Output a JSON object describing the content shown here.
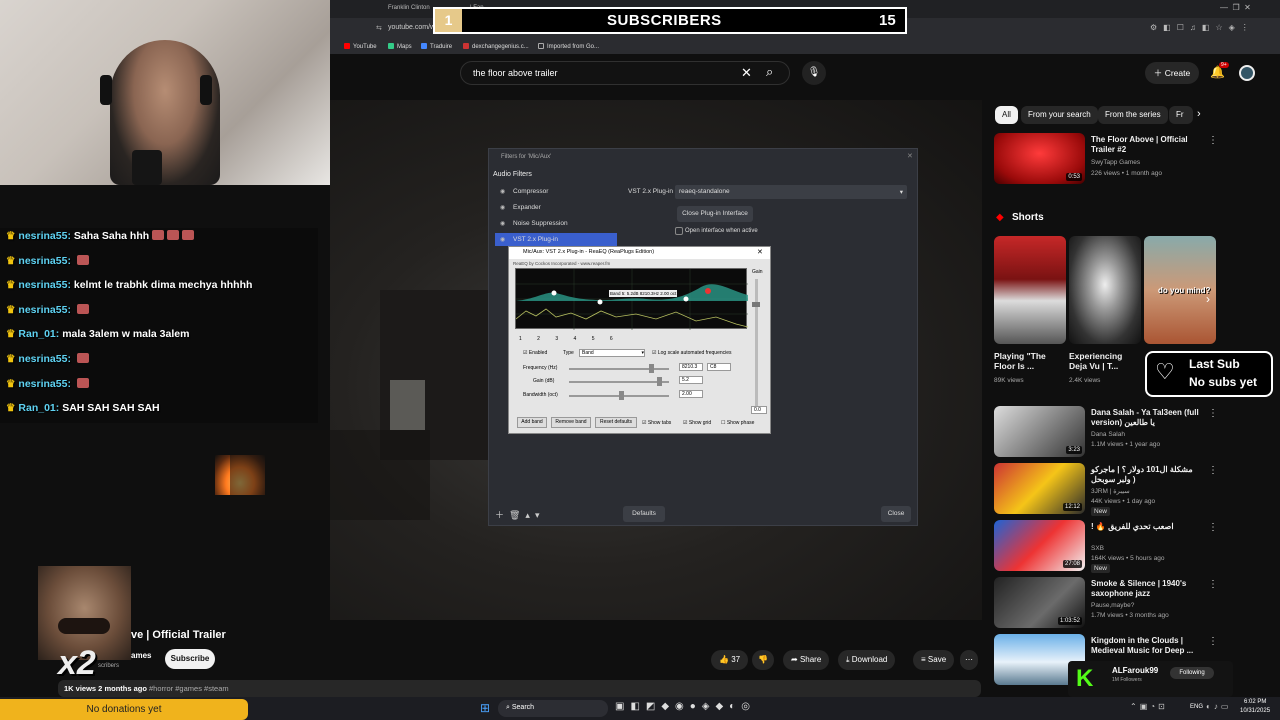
{
  "browser": {
    "tabs": [
      "Franklin Clinton",
      "| Fan"
    ],
    "url": "youtube.com/watch?v=AVNJbbKOydc",
    "bookmarks": [
      "YouTube",
      "Maps",
      "Traduire",
      "dexchangegenius.c...",
      "Imported from Go..."
    ]
  },
  "overlay": {
    "subscribers_label": "SUBSCRIBERS",
    "subscribers_count": "15",
    "subscribers_left": "1",
    "last_sub_title": "Last Sub",
    "last_sub_value": "No subs yet",
    "donations": "No donations yet",
    "multiplier": "x2"
  },
  "chat": [
    {
      "user": "nesrina55:",
      "msg": "Saha Saha hhh"
    },
    {
      "user": "nesrina55:",
      "msg": ""
    },
    {
      "user": "nesrina55:",
      "msg": "kelmt le trabhk dima mechya hhhhh"
    },
    {
      "user": "nesrina55:",
      "msg": ""
    },
    {
      "user": "Ran_01:",
      "msg": "mala 3alem w mala 3alem"
    },
    {
      "user": "nesrina55:",
      "msg": ""
    },
    {
      "user": "nesrina55:",
      "msg": ""
    },
    {
      "user": "Ran_01:",
      "msg": "SAH SAH SAH SAH"
    }
  ],
  "youtube": {
    "search_value": "the floor above trailer",
    "create_label": "Create",
    "notif_count": "9+",
    "video_title": "ve | Official Trailer",
    "channel": "ames",
    "channel_subs": "scribers",
    "subscribe": "Subscribe",
    "likes": "37",
    "share": "Share",
    "download": "Download",
    "save": "Save",
    "views_line": "1K views  2 months ago",
    "tags": "#horror #games #steam",
    "chips": [
      "All",
      "From your search",
      "From the series",
      "Fr"
    ],
    "shorts_label": "Shorts",
    "shorts": [
      {
        "title": "Playing \"The Floor Is ...",
        "views": "89K views"
      },
      {
        "title": "Experiencing Deja Vu | T...",
        "views": "2.4K views"
      },
      {
        "title": "do you mind?",
        "views": ""
      }
    ],
    "videos": [
      {
        "title": "The Floor Above | Official Trailer #2",
        "channel": "SwyTapp Games",
        "meta": "226 views • 1 month ago",
        "dur": "0:53"
      },
      {
        "title": "Dana Salah - Ya Tal3een (full version) يا طالعين",
        "channel": "Dana Salah",
        "meta": "1.1M views • 1 year ago",
        "dur": "3:23"
      },
      {
        "title": "مشكلة ال101 دولار ؟ | ماجركو ولبر سوبحل )",
        "channel": "3JRM | سيبرة",
        "meta": "44K views • 1 day ago",
        "dur": "12:12",
        "badge": "New"
      },
      {
        "title": "! 🔥 اصعب تحدي للفريق",
        "channel": "SXB",
        "meta": "164K views • 5 hours ago",
        "dur": "27:08",
        "badge": "New"
      },
      {
        "title": "Smoke & Silence | 1940's saxophone jazz",
        "channel": "Pause,maybe?",
        "meta": "1.7M views • 3 months ago",
        "dur": "1:03:52"
      },
      {
        "title": "Kingdom in the Clouds | Medieval Music for Deep ...",
        "channel": "",
        "meta": "",
        "dur": "1:3"
      }
    ],
    "follow": {
      "name": "ALFarouk99",
      "sub": "1M Followers",
      "btn": "Following"
    }
  },
  "obs": {
    "title": "Filters for 'Mic/Aux'",
    "section": "Audio Filters",
    "filters": [
      "Compressor",
      "Expander",
      "Noise Suppression",
      "VST 2.x Plug-in"
    ],
    "plugin_label": "VST 2.x Plug-in",
    "plugin_value": "reaeq-standalone",
    "close_interface": "Close Plug-in Interface",
    "open_when_active": "Open interface when active",
    "defaults": "Defaults",
    "close": "Close"
  },
  "reaeq": {
    "title": "Mic/Aux: VST 2.x Plug-in - ReaEQ (ReaPlugs Edition)",
    "credit": "ReaEQ by Cockos Incorporated - www.reaper.fm",
    "gain_label": "Gain",
    "band_tooltip": "Band 5: 5.2dB 8210.3Hz 2.00 oct",
    "band_tabs": [
      "1",
      "2",
      "3",
      "4",
      "5",
      "6"
    ],
    "enabled": "Enabled",
    "type_label": "Type",
    "type_value": "Band",
    "log_scale": "Log scale automated frequencies",
    "freq_label": "Frequency (Hz)",
    "freq_value": "8210.3",
    "freq_note": "C8",
    "gain_db_label": "Gain (dB)",
    "gain_value": "5.2",
    "bw_label": "Bandwidth (oct)",
    "bw_value": "2.00",
    "gain_readout": "0.0",
    "add_band": "Add band",
    "remove_band": "Remove band",
    "reset": "Reset defaults",
    "show_tabs": "Show tabs",
    "show_grid": "Show grid",
    "show_phase": "Show phase"
  },
  "taskbar": {
    "search": "Search",
    "lang": "ENG",
    "time": "6:02 PM",
    "date": "10/31/2025"
  }
}
